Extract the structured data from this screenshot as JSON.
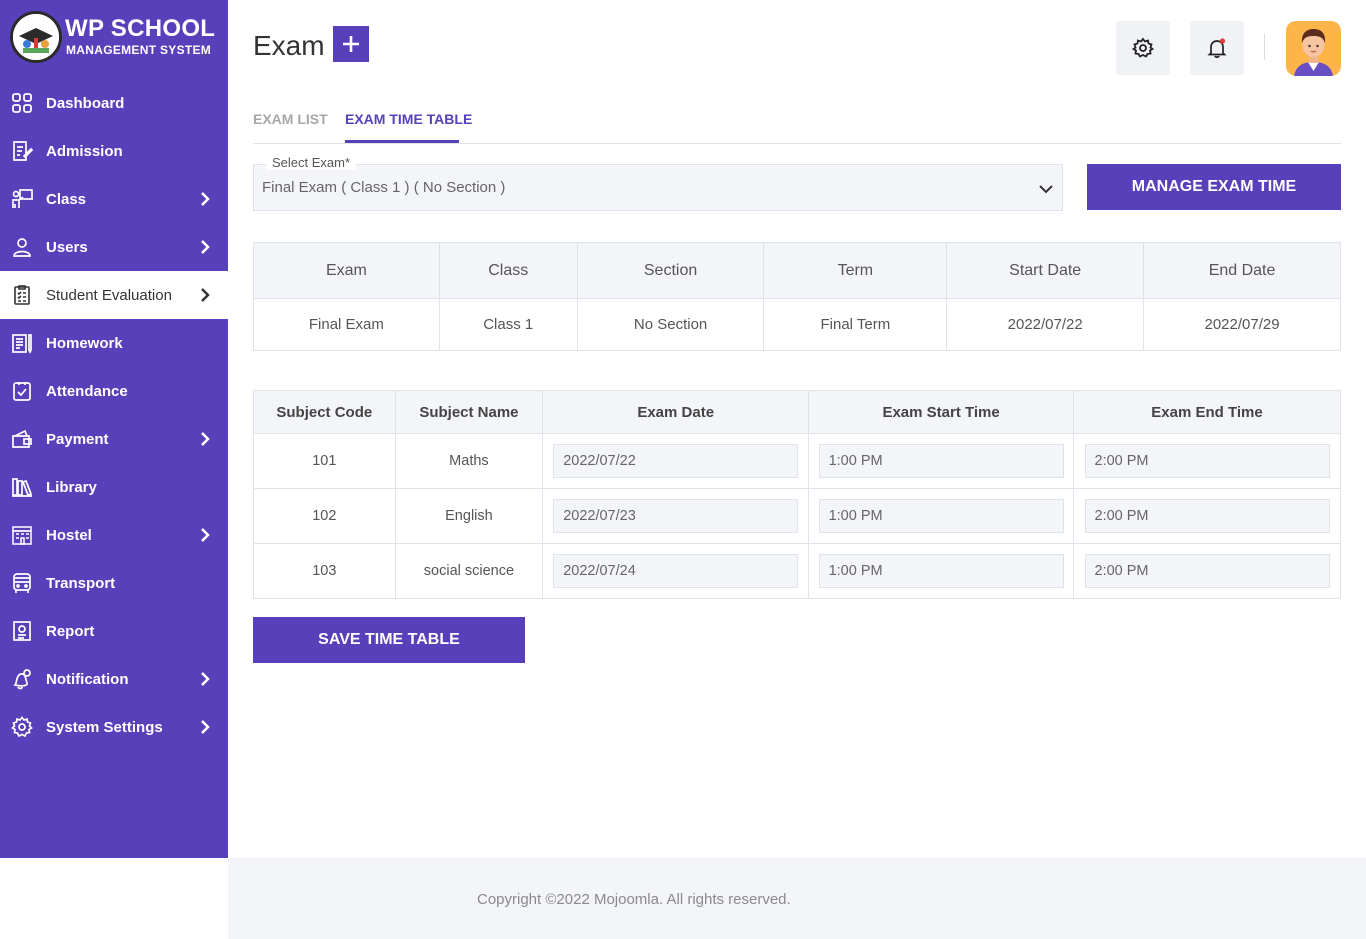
{
  "brand": {
    "title": "WP SCHOOL",
    "subtitle": "MANAGEMENT SYSTEM"
  },
  "sidebar": {
    "items": [
      {
        "label": "Dashboard",
        "icon": "dashboard-icon",
        "has_submenu": false
      },
      {
        "label": "Admission",
        "icon": "admission-icon",
        "has_submenu": false
      },
      {
        "label": "Class",
        "icon": "class-icon",
        "has_submenu": true
      },
      {
        "label": "Users",
        "icon": "user-icon",
        "has_submenu": true
      },
      {
        "label": "Student Evaluation",
        "icon": "evaluation-icon",
        "has_submenu": true,
        "active": true
      },
      {
        "label": "Homework",
        "icon": "homework-icon",
        "has_submenu": false
      },
      {
        "label": "Attendance",
        "icon": "attendance-icon",
        "has_submenu": false
      },
      {
        "label": "Payment",
        "icon": "payment-icon",
        "has_submenu": true
      },
      {
        "label": "Library",
        "icon": "library-icon",
        "has_submenu": false
      },
      {
        "label": "Hostel",
        "icon": "hostel-icon",
        "has_submenu": true
      },
      {
        "label": "Transport",
        "icon": "bus-icon",
        "has_submenu": false
      },
      {
        "label": "Report",
        "icon": "report-icon",
        "has_submenu": false
      },
      {
        "label": "Notification",
        "icon": "notification-icon",
        "has_submenu": true
      },
      {
        "label": "System Settings",
        "icon": "settings-icon",
        "has_submenu": true
      }
    ]
  },
  "header": {
    "title": "Exam",
    "add_icon": "plus-icon",
    "settings_icon": "gear-icon",
    "notification_icon": "bell-icon"
  },
  "tabs": [
    {
      "label": "EXAM LIST",
      "active": false
    },
    {
      "label": "EXAM TIME TABLE",
      "active": true
    }
  ],
  "select_exam": {
    "label": "Select Exam*",
    "value": "Final Exam ( Class 1 ) ( No Section )"
  },
  "manage_button": "MANAGE EXAM TIME",
  "exam_info": {
    "headers": [
      "Exam",
      "Class",
      "Section",
      "Term",
      "Start Date",
      "End Date"
    ],
    "row": [
      "Final Exam",
      "Class 1",
      "No Section",
      "Final Term",
      "2022/07/22",
      "2022/07/29"
    ]
  },
  "time_table": {
    "headers": [
      "Subject Code",
      "Subject Name",
      "Exam Date",
      "Exam Start Time",
      "Exam End Time"
    ],
    "rows": [
      {
        "code": "101",
        "name": "Maths",
        "date": "2022/07/22",
        "start": "1:00 PM",
        "end": "2:00 PM"
      },
      {
        "code": "102",
        "name": "English",
        "date": "2022/07/23",
        "start": "1:00 PM",
        "end": "2:00 PM"
      },
      {
        "code": "103",
        "name": "social science",
        "date": "2022/07/24",
        "start": "1:00 PM",
        "end": "2:00 PM"
      }
    ]
  },
  "save_button": "SAVE TIME TABLE",
  "footer": {
    "text": "Copyright ©2022 Mojoomla. All rights reserved."
  },
  "colors": {
    "primary": "#5840bb",
    "avatar_bg": "#fdb54a",
    "light_bg": "#f3f5f9",
    "notification_dot": "#e53935"
  }
}
